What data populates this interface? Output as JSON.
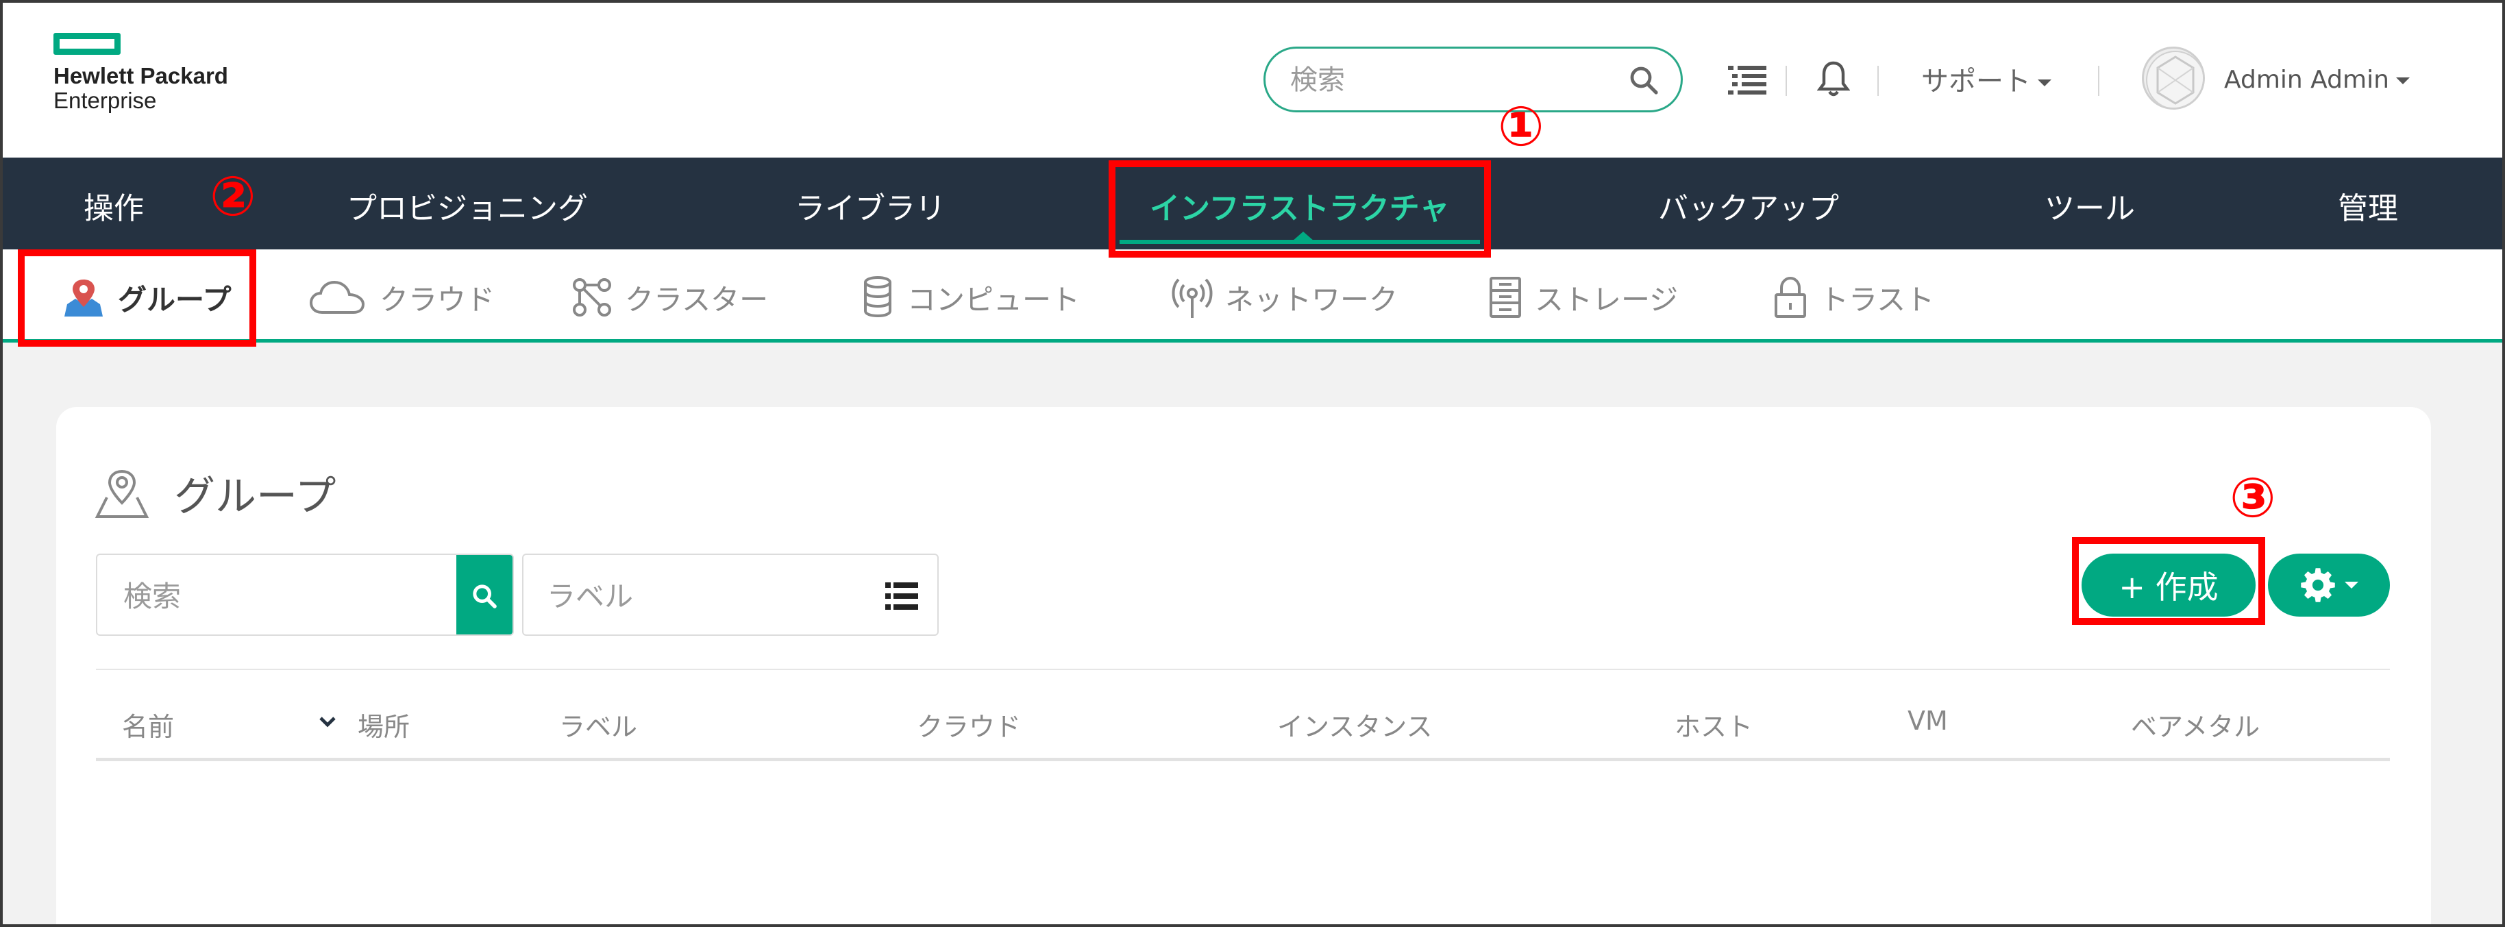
{
  "brand": {
    "line1": "Hewlett Packard",
    "line2": "Enterprise"
  },
  "header": {
    "search_placeholder": "検索",
    "support_label": "サポート",
    "user_label": "Admin Admin"
  },
  "main_nav": [
    {
      "label": "操作"
    },
    {
      "label": "プロビジョニング"
    },
    {
      "label": "ライブラリ"
    },
    {
      "label": "インフラストラクチャ",
      "active": true
    },
    {
      "label": "バックアップ"
    },
    {
      "label": "ツール"
    },
    {
      "label": "管理"
    }
  ],
  "sub_nav": [
    {
      "label": "グループ",
      "icon": "map-pin-icon",
      "active": true
    },
    {
      "label": "クラウド",
      "icon": "cloud-icon"
    },
    {
      "label": "クラスター",
      "icon": "cluster-icon"
    },
    {
      "label": "コンピュート",
      "icon": "database-icon"
    },
    {
      "label": "ネットワーク",
      "icon": "antenna-icon"
    },
    {
      "label": "ストレージ",
      "icon": "storage-icon"
    },
    {
      "label": "トラスト",
      "icon": "lock-icon"
    }
  ],
  "page": {
    "title": "グループ",
    "search_placeholder": "検索",
    "label_placeholder": "ラベル",
    "create_label": "+ 作成",
    "columns": [
      "名前",
      "場所",
      "ラベル",
      "クラウド",
      "インスタンス",
      "ホスト",
      "VM",
      "ベアメタル"
    ],
    "rows": []
  },
  "annotations": [
    "①",
    "②",
    "③"
  ],
  "colors": {
    "accent": "#01a982",
    "nav_bg": "#253241",
    "active_nav_text": "#2cd5a6",
    "annotation": "#ff0000"
  }
}
